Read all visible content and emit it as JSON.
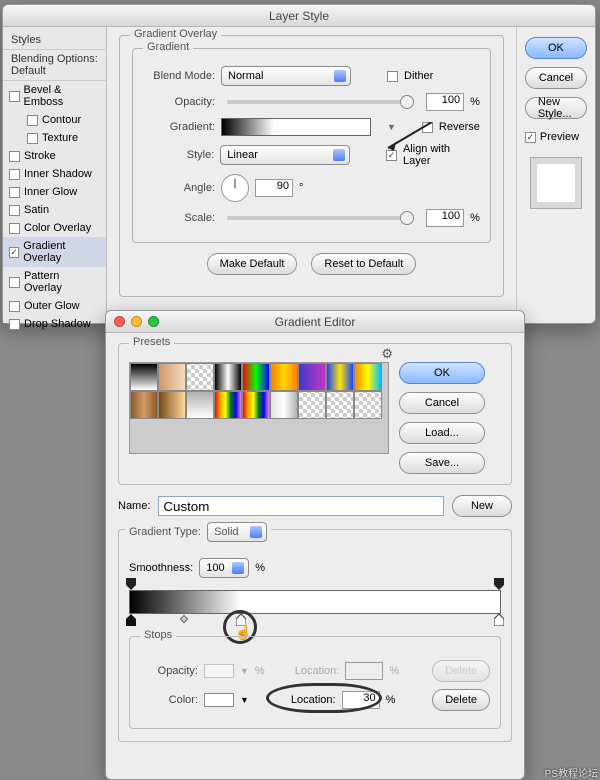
{
  "layerStyle": {
    "title": "Layer Style",
    "stylesHeader": "Styles",
    "blendingHeader": "Blending Options: Default",
    "styleRows": [
      {
        "label": "Bevel & Emboss",
        "checked": false
      },
      {
        "label": "Contour",
        "checked": false,
        "sub": true
      },
      {
        "label": "Texture",
        "checked": false,
        "sub": true
      },
      {
        "label": "Stroke",
        "checked": false
      },
      {
        "label": "Inner Shadow",
        "checked": false
      },
      {
        "label": "Inner Glow",
        "checked": false
      },
      {
        "label": "Satin",
        "checked": false
      },
      {
        "label": "Color Overlay",
        "checked": false
      },
      {
        "label": "Gradient Overlay",
        "checked": true,
        "active": true
      },
      {
        "label": "Pattern Overlay",
        "checked": false
      },
      {
        "label": "Outer Glow",
        "checked": false
      },
      {
        "label": "Drop Shadow",
        "checked": false
      }
    ],
    "sectionTitle": "Gradient Overlay",
    "subsection": "Gradient",
    "labels": {
      "blendMode": "Blend Mode:",
      "dither": "Dither",
      "opacity": "Opacity:",
      "gradient": "Gradient:",
      "reverse": "Reverse",
      "style": "Style:",
      "align": "Align with Layer",
      "angle": "Angle:",
      "scale": "Scale:",
      "pct": "%",
      "deg": "°"
    },
    "values": {
      "blendMode": "Normal",
      "opacity": "100",
      "style": "Linear",
      "angle": "90",
      "scale": "100",
      "ditherChecked": false,
      "reverseChecked": false,
      "alignChecked": true
    },
    "buttons": {
      "makeDefault": "Make Default",
      "resetDefault": "Reset to Default",
      "ok": "OK",
      "cancel": "Cancel",
      "newStyle": "New Style...",
      "preview": "Preview"
    },
    "previewChecked": true
  },
  "gradEditor": {
    "title": "Gradient Editor",
    "presetsLabel": "Presets",
    "swatches": [
      "linear-gradient(#000,#fff)",
      "linear-gradient(90deg,#cf966a,#f4dcbf)",
      "repeating-conic-gradient(#ccc 0 25%,#fff 0 50%) 0/8px 8px",
      "linear-gradient(90deg,#000,#fff,#000)",
      "linear-gradient(90deg,#ff0000,#00ff00,#0000ff)",
      "linear-gradient(90deg,#ff7e00,#ffd800,#ff7e00)",
      "linear-gradient(90deg,#4239c7,#c135c7)",
      "linear-gradient(90deg,#1a44ff,#ffe600,#1a44ff)",
      "linear-gradient(90deg,#ff8a00,#ff0,#00baff)",
      "linear-gradient(90deg,#8a5a2a,#d19a66,#8a5a2a)",
      "linear-gradient(90deg,#7a4a1a,#ffd899)",
      "linear-gradient(#b0b0b0,#fff)",
      "linear-gradient(90deg,red,orange,yellow,green,blue,violet)",
      "linear-gradient(90deg,red,orange,yellow,green,blue,violet)",
      "linear-gradient(90deg,#e0e0e0,#fff,#b0b0b0)",
      "repeating-conic-gradient(#ccc 0 25%,#fff 0 50%) 0/8px 8px",
      "repeating-conic-gradient(#ccc 0 25%,#fff 0 50%) 0/8px 8px",
      "repeating-conic-gradient(#ccc 0 25%,#fff 0 50%) 0/8px 8px"
    ],
    "buttons": {
      "ok": "OK",
      "cancel": "Cancel",
      "load": "Load...",
      "save": "Save...",
      "new": "New",
      "delete": "Delete"
    },
    "nameLabel": "Name:",
    "nameValue": "Custom",
    "gtLabel": "Gradient Type:",
    "gtValue": "Solid",
    "smoothLabel": "Smoothness:",
    "smoothValue": "100",
    "stopsLabel": "Stops",
    "opacityLabel": "Opacity:",
    "colorLabel": "Color:",
    "locationLabel": "Location:",
    "locationValue": "30",
    "pct": "%"
  },
  "watermark": "PS教程论坛"
}
